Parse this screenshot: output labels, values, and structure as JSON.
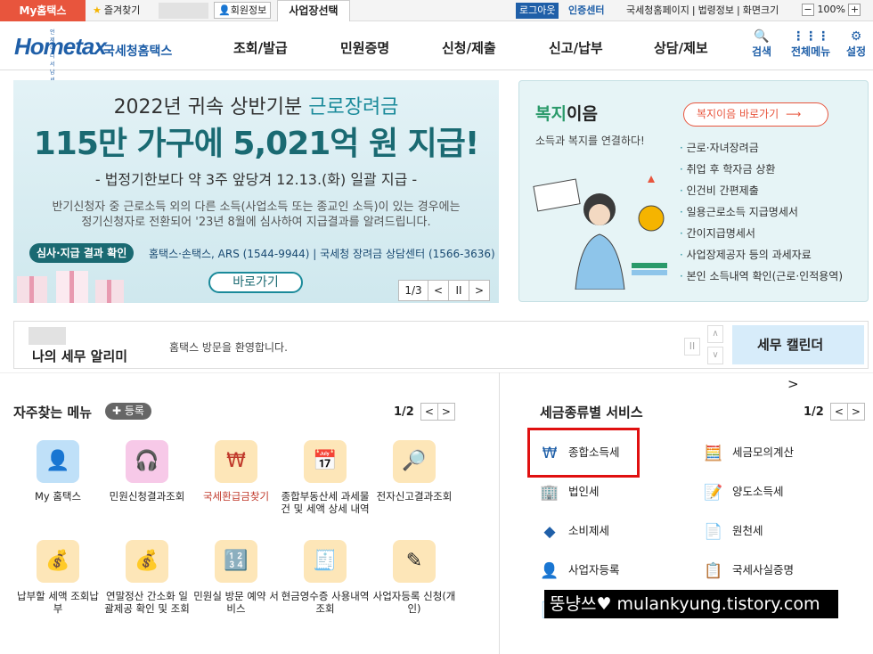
{
  "topbar": {
    "my_home": "My홈택스",
    "favorites": "즐겨찾기",
    "member_info": "회원정보",
    "business_select": "사업장선택",
    "logout": "로그아웃",
    "cert_center": "인증센터",
    "links": [
      "국세청홈페이지",
      "법령정보",
      "화면크기"
    ],
    "zoom_minus": "−",
    "zoom_value": "100%",
    "zoom_plus": "+"
  },
  "logo": {
    "sub": "언제어디서 납세서비스",
    "home": "Hometax",
    "nts": "국세청홈택스"
  },
  "gnb": [
    "조회/발급",
    "민원증명",
    "신청/제출",
    "신고/납부",
    "상담/제보"
  ],
  "util": {
    "search": "검색",
    "all_menu": "전체메뉴",
    "settings": "설정"
  },
  "banner": {
    "line1_pre": "2022년 귀속 상반기분 ",
    "line1_accent": "근로장려금",
    "line2": "115만 가구에 5,021억 원 지급!",
    "line3": "- 법정기한보다 약 3주 앞당겨 12.13.(화) 일괄 지급 -",
    "line4a": "반기신청자 중 근로소득 외의 다른 소득(사업소득 또는 종교인 소득)이 있는 경우에는",
    "line4b": "정기신청자로 전환되어 '23년 8월에 심사하여 지급결과를 알려드립니다.",
    "tag": "심사·지급 결과 확인",
    "tag_text": "홈택스·손택스, ARS (1544-9944) | 국세청 장려금 상담센터 (1566-3636)",
    "go": "바로가기",
    "page": "1/3",
    "pager_prev": "<",
    "pager_pause": "II",
    "pager_next": ">"
  },
  "welfare": {
    "title_a": "복지",
    "title_b": "이음",
    "desc": "소득과 복지를 연결하다!",
    "go": "복지이음 바로가기",
    "items": [
      "근로·자녀장려금",
      "취업 후 학자금 상환",
      "인건비 간편제출",
      "일용근로소득 지급명세서",
      "간이지급명세서",
      "사업장제공자 등의 과세자료",
      "본인 소득내역 확인(근로·인적용역)"
    ]
  },
  "alarm": {
    "title": "나의 세무 알리미",
    "message": "홈택스 방문을 환영합니다.",
    "pause": "II",
    "calendar": "세무 캘린더",
    "calendar_arrow": ">"
  },
  "freq": {
    "title": "자주찾는 메뉴",
    "register": "✚ 등록",
    "page": "1/2",
    "prev": "<",
    "next": ">",
    "items": [
      {
        "label": "My 홈택스",
        "icon": "person-icon",
        "color": "#bfe0f8"
      },
      {
        "label": "민원신청결과조회",
        "icon": "headset-icon",
        "color": "#f7c9e8"
      },
      {
        "label": "국세환급금찾기",
        "icon": "refund-icon",
        "color": "#fde6b8",
        "accent": "#c0392b"
      },
      {
        "label": "종합부동산세 과세물건 및 세액 상세 내역",
        "icon": "calendar-icon",
        "color": "#fde6b8"
      },
      {
        "label": "전자신고결과조회",
        "icon": "search-doc-icon",
        "color": "#fde6b8"
      },
      {
        "label": "납부할 세액 조회납부",
        "icon": "moneybag-icon",
        "color": "#fde6b8"
      },
      {
        "label": "연말정산 간소화 일괄제공 확인 및 조회",
        "icon": "moneybag-icon",
        "color": "#fde6b8"
      },
      {
        "label": "민원실 방문 예약 서비스",
        "icon": "counter-icon",
        "color": "#fde6b8"
      },
      {
        "label": "현금영수증 사용내역조회",
        "icon": "receipt-icon",
        "color": "#fde6b8"
      },
      {
        "label": "사업자등록 신청(개인)",
        "icon": "person-edit-icon",
        "color": "#fde6b8"
      }
    ]
  },
  "taxsvc": {
    "title": "세금종류별 서비스",
    "page": "1/2",
    "prev": "<",
    "next": ">",
    "items": [
      {
        "label": "종합소득세",
        "icon": "won-bag-icon"
      },
      {
        "label": "세금모의계산",
        "icon": "calculator-icon"
      },
      {
        "label": "법인세",
        "icon": "building-icon"
      },
      {
        "label": "양도소득세",
        "icon": "document-pen-icon"
      },
      {
        "label": "소비제세",
        "icon": "diamond-icon"
      },
      {
        "label": "원천세",
        "icon": "sal-doc-icon"
      },
      {
        "label": "사업자등록",
        "icon": "person-icon"
      },
      {
        "label": "국세사실증명",
        "icon": "certificate-icon"
      },
      {
        "label": "",
        "icon": "document-icon"
      }
    ]
  },
  "watermark": "뚱냥쓰♥ mulankyung.tistory.com"
}
